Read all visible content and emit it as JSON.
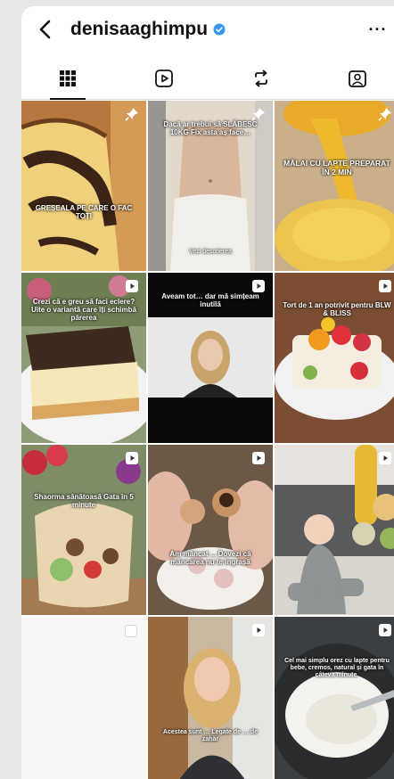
{
  "header": {
    "username": "denisaaghimpu",
    "verified": true,
    "more_label": "···"
  },
  "tabs": [
    {
      "name": "grid",
      "icon": "grid-icon"
    },
    {
      "name": "reels",
      "icon": "reels-icon"
    },
    {
      "name": "reposts",
      "icon": "repost-icon"
    },
    {
      "name": "tagged",
      "icon": "tagged-icon"
    }
  ],
  "accent": "#3897f0",
  "posts": [
    {
      "caption": "GREȘEALA PE CARE O FAC TOȚI",
      "type": "pinned"
    },
    {
      "caption": "Dacă ar trebui să SLĂBESC 10KG Fix asta aș face…",
      "subcaption": "Vezi descrierea",
      "type": "pinned"
    },
    {
      "caption": "MĂLAI CU LAPTE PREPARAT ÎN 2 MIN",
      "type": "pinned"
    },
    {
      "caption": "Crezi că e greu să faci eclere? Uite o variantă care îți schimbă părerea",
      "type": "reel"
    },
    {
      "caption": "Aveam tot… dar mă simțeam inutilă",
      "type": "reel"
    },
    {
      "caption": "Tort de 1 an potrivit pentru BLW & BLISS",
      "type": "reel"
    },
    {
      "caption": "Shaorma sănătoasă Gata în 5 minute",
      "type": "reel"
    },
    {
      "caption": "Am mâncat ... Dovezi că mâncarea nu te îngrașă",
      "type": "reel"
    },
    {
      "caption": "",
      "type": "reel"
    },
    {
      "caption": "",
      "type": "multi"
    },
    {
      "caption": "Acestea sunt … Legate de … de zahăr",
      "type": "reel"
    },
    {
      "caption": "Cel mai simplu orez cu lapte pentru bebe, cremos, natural și gata în câteva minute.",
      "type": "reel"
    }
  ]
}
